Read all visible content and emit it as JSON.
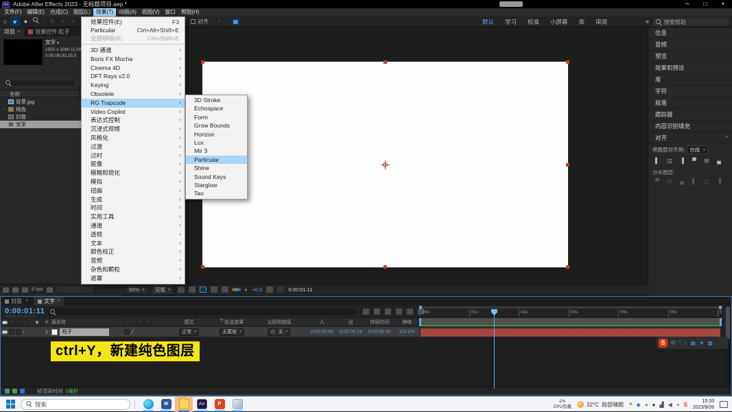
{
  "icons": {
    "menu": "≡",
    "chev_r": "›",
    "chev_d": "▾",
    "overflow": "»",
    "home": "⌂",
    "cursor": "►",
    "rotate": "↻",
    "plus": "+",
    "volume_tri": "◀",
    "caret_up": "^"
  },
  "titlebar": {
    "app_label": "Ae",
    "title": "Adobe After Effects 2023 - 无标题项目.aep *"
  },
  "window_controls": {
    "minimize": "─",
    "maximize": "□",
    "close": "×"
  },
  "menubar": {
    "items": [
      {
        "label": "文件(F)"
      },
      {
        "label": "编辑(E)"
      },
      {
        "label": "合成(C)"
      },
      {
        "label": "图层(L)"
      },
      {
        "label": "效果(T)",
        "active": true
      },
      {
        "label": "动画(A)"
      },
      {
        "label": "视图(V)"
      },
      {
        "label": "窗口"
      },
      {
        "label": "帮助(H)"
      }
    ]
  },
  "toolbar": {
    "snap_label": "对齐",
    "help_search_placeholder": "搜索帮助",
    "workspace_tabs": [
      {
        "label": "默认",
        "active": true
      },
      {
        "label": "学习"
      },
      {
        "label": "标准"
      },
      {
        "label": "小屏幕"
      },
      {
        "label": "库"
      },
      {
        "label": "审阅"
      }
    ]
  },
  "effects_menu": {
    "top_items": [
      {
        "label": "效果控件(E)",
        "shortcut": "F3"
      },
      {
        "label": "Particular",
        "shortcut": "Ctrl+Alt+Shift+E"
      },
      {
        "label": "全部移除(R)",
        "shortcut": "Ctrl+Shift+E",
        "disabled": true
      }
    ],
    "categories": [
      {
        "label": "3D 通道"
      },
      {
        "label": "Boris FX Mocha"
      },
      {
        "label": "Cinema 4D"
      },
      {
        "label": "DFT Rays v2.0"
      },
      {
        "label": "Keying"
      },
      {
        "label": "Obsolete"
      },
      {
        "label": "RG Trapcode",
        "highlighted": true
      },
      {
        "label": "Video Copilot"
      },
      {
        "label": "表达式控制"
      },
      {
        "label": "沉浸式视频"
      },
      {
        "label": "风格化"
      },
      {
        "label": "过渡"
      },
      {
        "label": "过时"
      },
      {
        "label": "抠像"
      },
      {
        "label": "模糊和锐化"
      },
      {
        "label": "模拟"
      },
      {
        "label": "扭曲"
      },
      {
        "label": "生成"
      },
      {
        "label": "时间"
      },
      {
        "label": "实用工具"
      },
      {
        "label": "通道"
      },
      {
        "label": "透视"
      },
      {
        "label": "文本"
      },
      {
        "label": "颜色校正"
      },
      {
        "label": "音频"
      },
      {
        "label": "杂色和颗粒"
      },
      {
        "label": "遮罩"
      }
    ]
  },
  "trapcode_submenu": {
    "items": [
      {
        "label": "3D Stroke"
      },
      {
        "label": "Echospace"
      },
      {
        "label": "Form"
      },
      {
        "label": "Grow Bounds"
      },
      {
        "label": "Horizon"
      },
      {
        "label": "Lux"
      },
      {
        "label": "Mir 3"
      },
      {
        "label": "Particular",
        "highlighted": true
      },
      {
        "label": "Shine"
      },
      {
        "label": "Sound Keys"
      },
      {
        "label": "Starglow"
      },
      {
        "label": "Tao"
      }
    ]
  },
  "project_panel": {
    "tab1": "项目",
    "tab2_label": "效果控件 粒子",
    "comp_name": "文字",
    "comp_line2": "1920 x 1080 (1.00",
    "comp_line3": "0:00:06:00,25.0",
    "name_header": "名称",
    "bpc": "8 bpc",
    "items": [
      {
        "label": "背景.jpg",
        "icon": "image"
      },
      {
        "label": "纯色",
        "icon": "folder",
        "expander": "›"
      },
      {
        "label": "封面",
        "icon": "comp"
      },
      {
        "label": "文字",
        "icon": "comp",
        "selected": true
      }
    ]
  },
  "comp_toolbar": {
    "zoom": "50%",
    "resolution": "完整",
    "exposure": "+0.0",
    "timecode": "0:00:01:11"
  },
  "right_panel": {
    "sections": [
      {
        "label": "信息"
      },
      {
        "label": "音频"
      },
      {
        "label": "预览"
      },
      {
        "label": "效果和预设"
      },
      {
        "label": "库"
      },
      {
        "label": "字符"
      },
      {
        "label": "段落"
      },
      {
        "label": "跟踪器"
      },
      {
        "label": "内容识别填充"
      }
    ],
    "align_title": "对齐",
    "align_to_label": "将图层对齐到:",
    "align_to_value": "合成",
    "distribute_label": "分布图层:",
    "align_buttons": [
      {
        "name": "align-left-button",
        "glyph": "▌"
      },
      {
        "name": "align-h-center-button",
        "glyph": "◫"
      },
      {
        "name": "align-right-button",
        "glyph": "▐"
      },
      {
        "name": "align-top-button",
        "glyph": "▀"
      },
      {
        "name": "align-v-center-button",
        "glyph": "⊟"
      },
      {
        "name": "align-bottom-button",
        "glyph": "▄"
      }
    ],
    "distribute_buttons": [
      {
        "name": "distribute-top-button",
        "glyph": "▀"
      },
      {
        "name": "distribute-v-center-button",
        "glyph": "⊟"
      },
      {
        "name": "distribute-bottom-button",
        "glyph": "▄"
      },
      {
        "name": "distribute-left-button",
        "glyph": "▌"
      },
      {
        "name": "distribute-h-center-button",
        "glyph": "◫"
      },
      {
        "name": "distribute-right-button",
        "glyph": "▐"
      }
    ]
  },
  "timeline": {
    "tab1": "封面",
    "tab2": "文字",
    "timecode": "0:00:01:11",
    "frame_info": "00036 (25.00 fps)",
    "col_source": "源名称",
    "col_matte_t": "T",
    "col_mode": "模式",
    "col_matte": "轨道遮罩",
    "col_parent": "父级和链接",
    "col_in": "入",
    "col_out": "出",
    "col_dur": "持续时间",
    "col_stretch": "伸缩",
    "layer_num": "1",
    "layer_name": "粒子",
    "layer_mode": "正常",
    "layer_matte": "无蒙版",
    "layer_parent": "无",
    "layer_in": "0:00:00:00",
    "layer_out": "0:00:05:24",
    "layer_dur": "0:00:06:00",
    "layer_stretch": "100.0%",
    "ruler_ticks": [
      ":00s",
      "01s",
      "02s",
      "03s",
      "04s",
      "05s",
      "06s"
    ],
    "status_label": "帧渲染时间",
    "status_value": "0毫秒"
  },
  "note": {
    "text": "ctrl+Y，新建纯色图层"
  },
  "sogou": {
    "logo": "S",
    "items": [
      {
        "name": "language-icon",
        "glyph": "中"
      },
      {
        "name": "punctuation-icon",
        "glyph": "”"
      },
      {
        "name": "microphone-icon",
        "glyph": "♪"
      },
      {
        "name": "keyboard-icon",
        "glyph": "▦"
      },
      {
        "name": "skin-icon",
        "glyph": "★"
      },
      {
        "name": "toolbox-icon",
        "glyph": "▩"
      }
    ]
  },
  "taskbar": {
    "search_placeholder": "搜索",
    "apps": [
      {
        "name": "edge-icon",
        "icon": "edge",
        "letter": ""
      },
      {
        "name": "word-icon",
        "icon": "word",
        "letter": "W"
      },
      {
        "name": "file-explorer-icon",
        "icon": "explorer",
        "letter": "",
        "active": true
      },
      {
        "name": "after-effects-icon",
        "icon": "ae",
        "letter": "Ae"
      },
      {
        "name": "powerpoint-icon",
        "icon": "ppt",
        "letter": "P"
      },
      {
        "name": "wps-icon",
        "icon": "wps",
        "letter": ""
      }
    ],
    "cpu_value": "1%",
    "cpu_label": "CPU负载",
    "weather_temp": "32°C",
    "weather_desc": "局部晴朗",
    "tray": [
      {
        "name": "tray-expand-icon",
        "glyph": "^",
        "color": "#444"
      },
      {
        "name": "security-shield-icon",
        "glyph": "◆",
        "color": "#2f7fd6"
      },
      {
        "name": "wechat-icon",
        "glyph": "●",
        "color": "#45b035"
      },
      {
        "name": "qq-icon",
        "glyph": "●",
        "color": "#2c2c2c"
      },
      {
        "name": "network-icon",
        "glyph": "▟",
        "color": "#555"
      },
      {
        "name": "volume-icon",
        "glyph": "◀",
        "color": "#555"
      },
      {
        "name": "game-cross-icon",
        "glyph": "+",
        "color": "#777"
      },
      {
        "name": "sogou-tray-icon",
        "glyph": "S",
        "color": "#e3350e"
      }
    ],
    "time": "15:33",
    "date": "2023/9/26"
  }
}
